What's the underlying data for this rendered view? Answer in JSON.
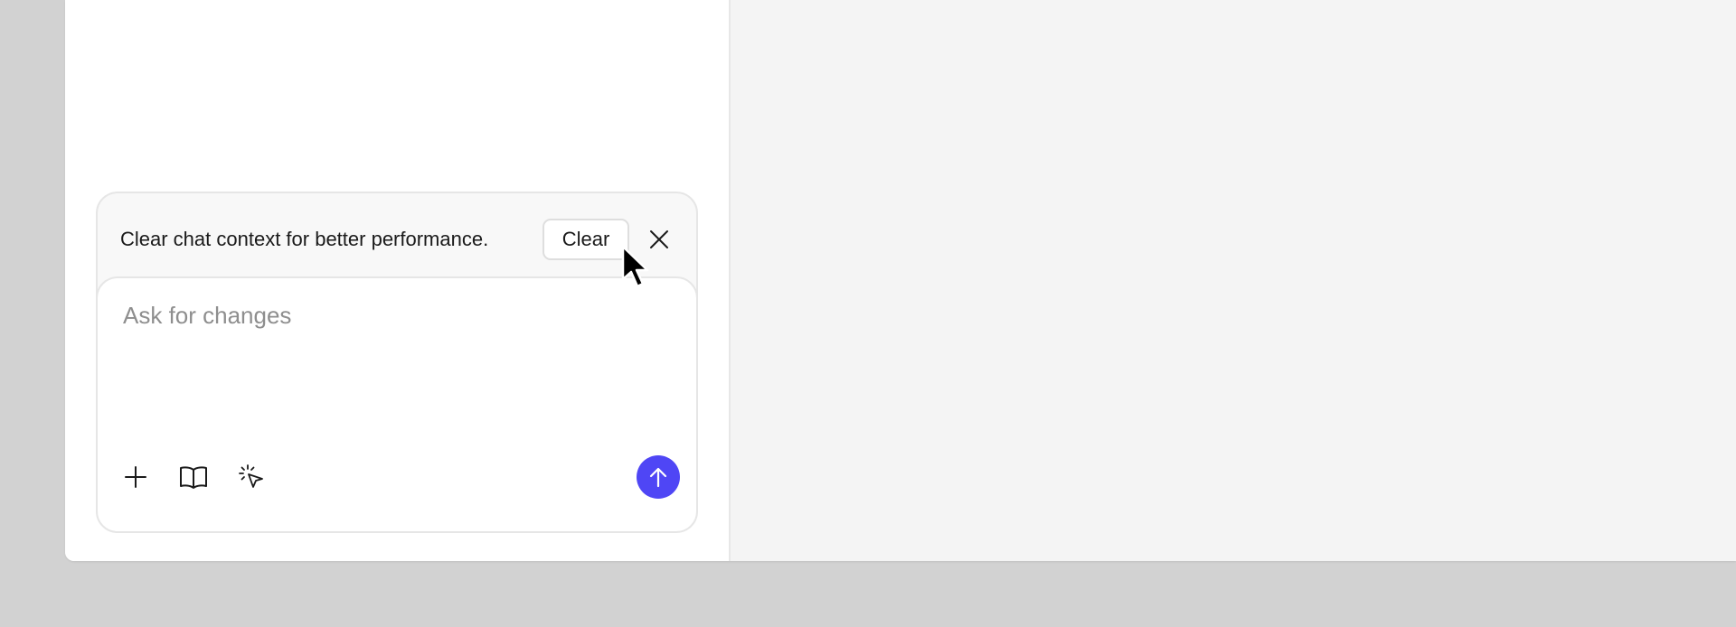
{
  "notice": {
    "text": "Clear chat context for better performance.",
    "clear_label": "Clear"
  },
  "input": {
    "placeholder": "Ask for changes",
    "value": ""
  },
  "toolbar": {
    "icons": [
      "plus-icon",
      "book-icon",
      "select-element-icon"
    ],
    "send_icon": "arrow-up-icon"
  },
  "colors": {
    "accent": "#4f46f5",
    "background": "#d2d2d2",
    "panel": "#ffffff",
    "preview": "#f4f4f4"
  }
}
